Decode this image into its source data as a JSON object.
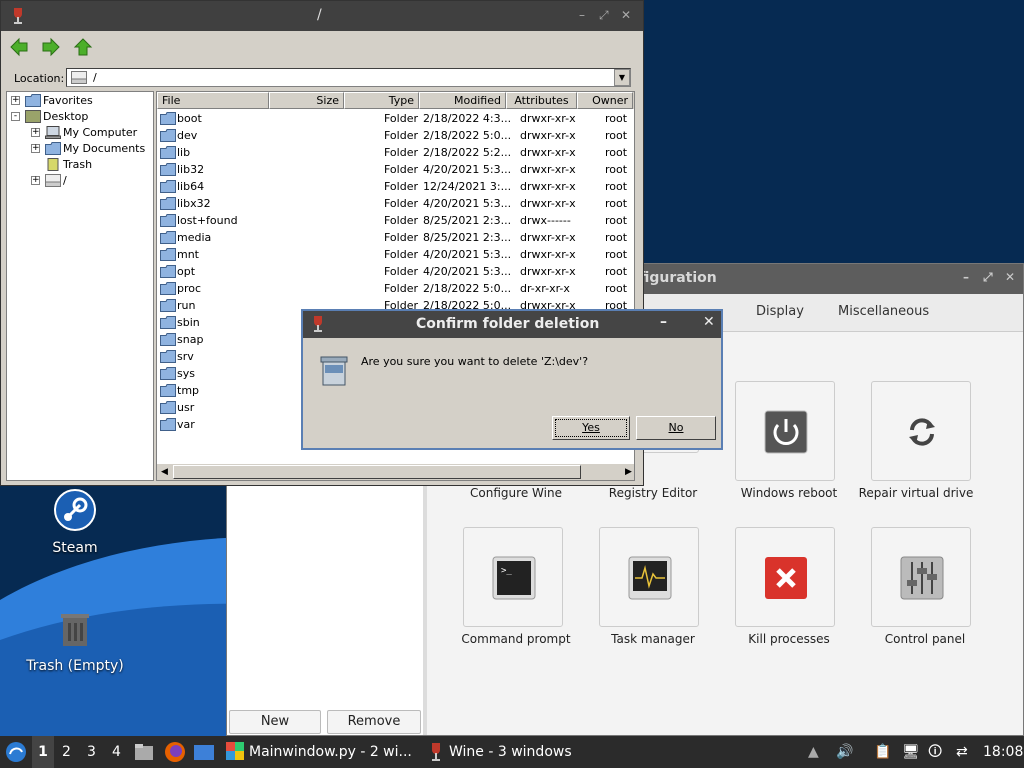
{
  "desktop": {
    "icons": [
      {
        "label": "Steam",
        "icon": "steam-icon"
      },
      {
        "label": "Trash (Empty)",
        "icon": "trash-icon"
      }
    ]
  },
  "config_window": {
    "title": "nfiguration",
    "tabs": [
      "Display",
      "Miscellaneous"
    ],
    "buttons": {
      "new": "New",
      "remove": "Remove"
    },
    "tiles": [
      {
        "label": "Configure Wine",
        "icon": "wine-config-icon"
      },
      {
        "label": "Registry Editor",
        "icon": "registry-icon"
      },
      {
        "label": "Windows reboot",
        "icon": "power-icon"
      },
      {
        "label": "Repair virtual drive",
        "icon": "refresh-icon"
      },
      {
        "label": "Command prompt",
        "icon": "terminal-icon"
      },
      {
        "label": "Task manager",
        "icon": "monitor-icon"
      },
      {
        "label": "Kill processes",
        "icon": "kill-icon"
      },
      {
        "label": "Control panel",
        "icon": "sliders-icon"
      }
    ]
  },
  "file_manager": {
    "title": "/",
    "location_label": "Location:",
    "location_value": "/",
    "tree": [
      {
        "label": "Favorites",
        "expander": "+"
      },
      {
        "label": "Desktop",
        "expander": "-"
      },
      {
        "label": "My Computer",
        "expander": "+"
      },
      {
        "label": "My Documents",
        "expander": "+"
      },
      {
        "label": "Trash",
        "expander": ""
      },
      {
        "label": "/",
        "expander": "+"
      }
    ],
    "columns": [
      "File",
      "Size",
      "Type",
      "Modified",
      "Attributes",
      "Owner"
    ],
    "rows": [
      {
        "name": "boot",
        "type": "Folder",
        "modified": "2/18/2022 4:3...",
        "attrs": "drwxr-xr-x",
        "owner": "root"
      },
      {
        "name": "dev",
        "type": "Folder",
        "modified": "2/18/2022 5:0...",
        "attrs": "drwxr-xr-x",
        "owner": "root"
      },
      {
        "name": "lib",
        "type": "Folder",
        "modified": "2/18/2022 5:2...",
        "attrs": "drwxr-xr-x",
        "owner": "root"
      },
      {
        "name": "lib32",
        "type": "Folder",
        "modified": "4/20/2021 5:3...",
        "attrs": "drwxr-xr-x",
        "owner": "root"
      },
      {
        "name": "lib64",
        "type": "Folder",
        "modified": "12/24/2021 3:...",
        "attrs": "drwxr-xr-x",
        "owner": "root"
      },
      {
        "name": "libx32",
        "type": "Folder",
        "modified": "4/20/2021 5:3...",
        "attrs": "drwxr-xr-x",
        "owner": "root"
      },
      {
        "name": "lost+found",
        "type": "Folder",
        "modified": "8/25/2021 2:3...",
        "attrs": "drwx------",
        "owner": "root"
      },
      {
        "name": "media",
        "type": "Folder",
        "modified": "8/25/2021 2:3...",
        "attrs": "drwxr-xr-x",
        "owner": "root"
      },
      {
        "name": "mnt",
        "type": "Folder",
        "modified": "4/20/2021 5:3...",
        "attrs": "drwxr-xr-x",
        "owner": "root"
      },
      {
        "name": "opt",
        "type": "Folder",
        "modified": "4/20/2021 5:3...",
        "attrs": "drwxr-xr-x",
        "owner": "root"
      },
      {
        "name": "proc",
        "type": "Folder",
        "modified": "2/18/2022 5:0...",
        "attrs": "dr-xr-xr-x",
        "owner": "root"
      },
      {
        "name": "run",
        "type": "Folder",
        "modified": "2/18/2022 5:0...",
        "attrs": "drwxr-xr-x",
        "owner": "root"
      },
      {
        "name": "sbin",
        "type": "",
        "modified": "",
        "attrs": "",
        "owner": ""
      },
      {
        "name": "snap",
        "type": "",
        "modified": "",
        "attrs": "",
        "owner": ""
      },
      {
        "name": "srv",
        "type": "",
        "modified": "",
        "attrs": "",
        "owner": ""
      },
      {
        "name": "sys",
        "type": "",
        "modified": "",
        "attrs": "",
        "owner": ""
      },
      {
        "name": "tmp",
        "type": "",
        "modified": "",
        "attrs": "",
        "owner": ""
      },
      {
        "name": "usr",
        "type": "",
        "modified": "",
        "attrs": "",
        "owner": ""
      },
      {
        "name": "var",
        "type": "",
        "modified": "",
        "attrs": "",
        "owner": ""
      }
    ]
  },
  "dialog": {
    "title": "Confirm folder deletion",
    "message": "Are you sure you want to delete 'Z:\\dev'?",
    "yes_label": "Yes",
    "no_label": "No"
  },
  "taskbar": {
    "workspaces": [
      "1",
      "2",
      "3",
      "4"
    ],
    "tasks": [
      {
        "label": "Mainwindow.py - 2 wi...",
        "icon": "python-icon"
      },
      {
        "label": "Wine - 3 windows",
        "icon": "wine-icon"
      }
    ],
    "clock": "18:08"
  },
  "colors": {
    "desktop_bg": "#062a52",
    "wave": "#2f7fdb",
    "dialog_border": "#5a7fb4",
    "kill_red": "#d9332b"
  }
}
